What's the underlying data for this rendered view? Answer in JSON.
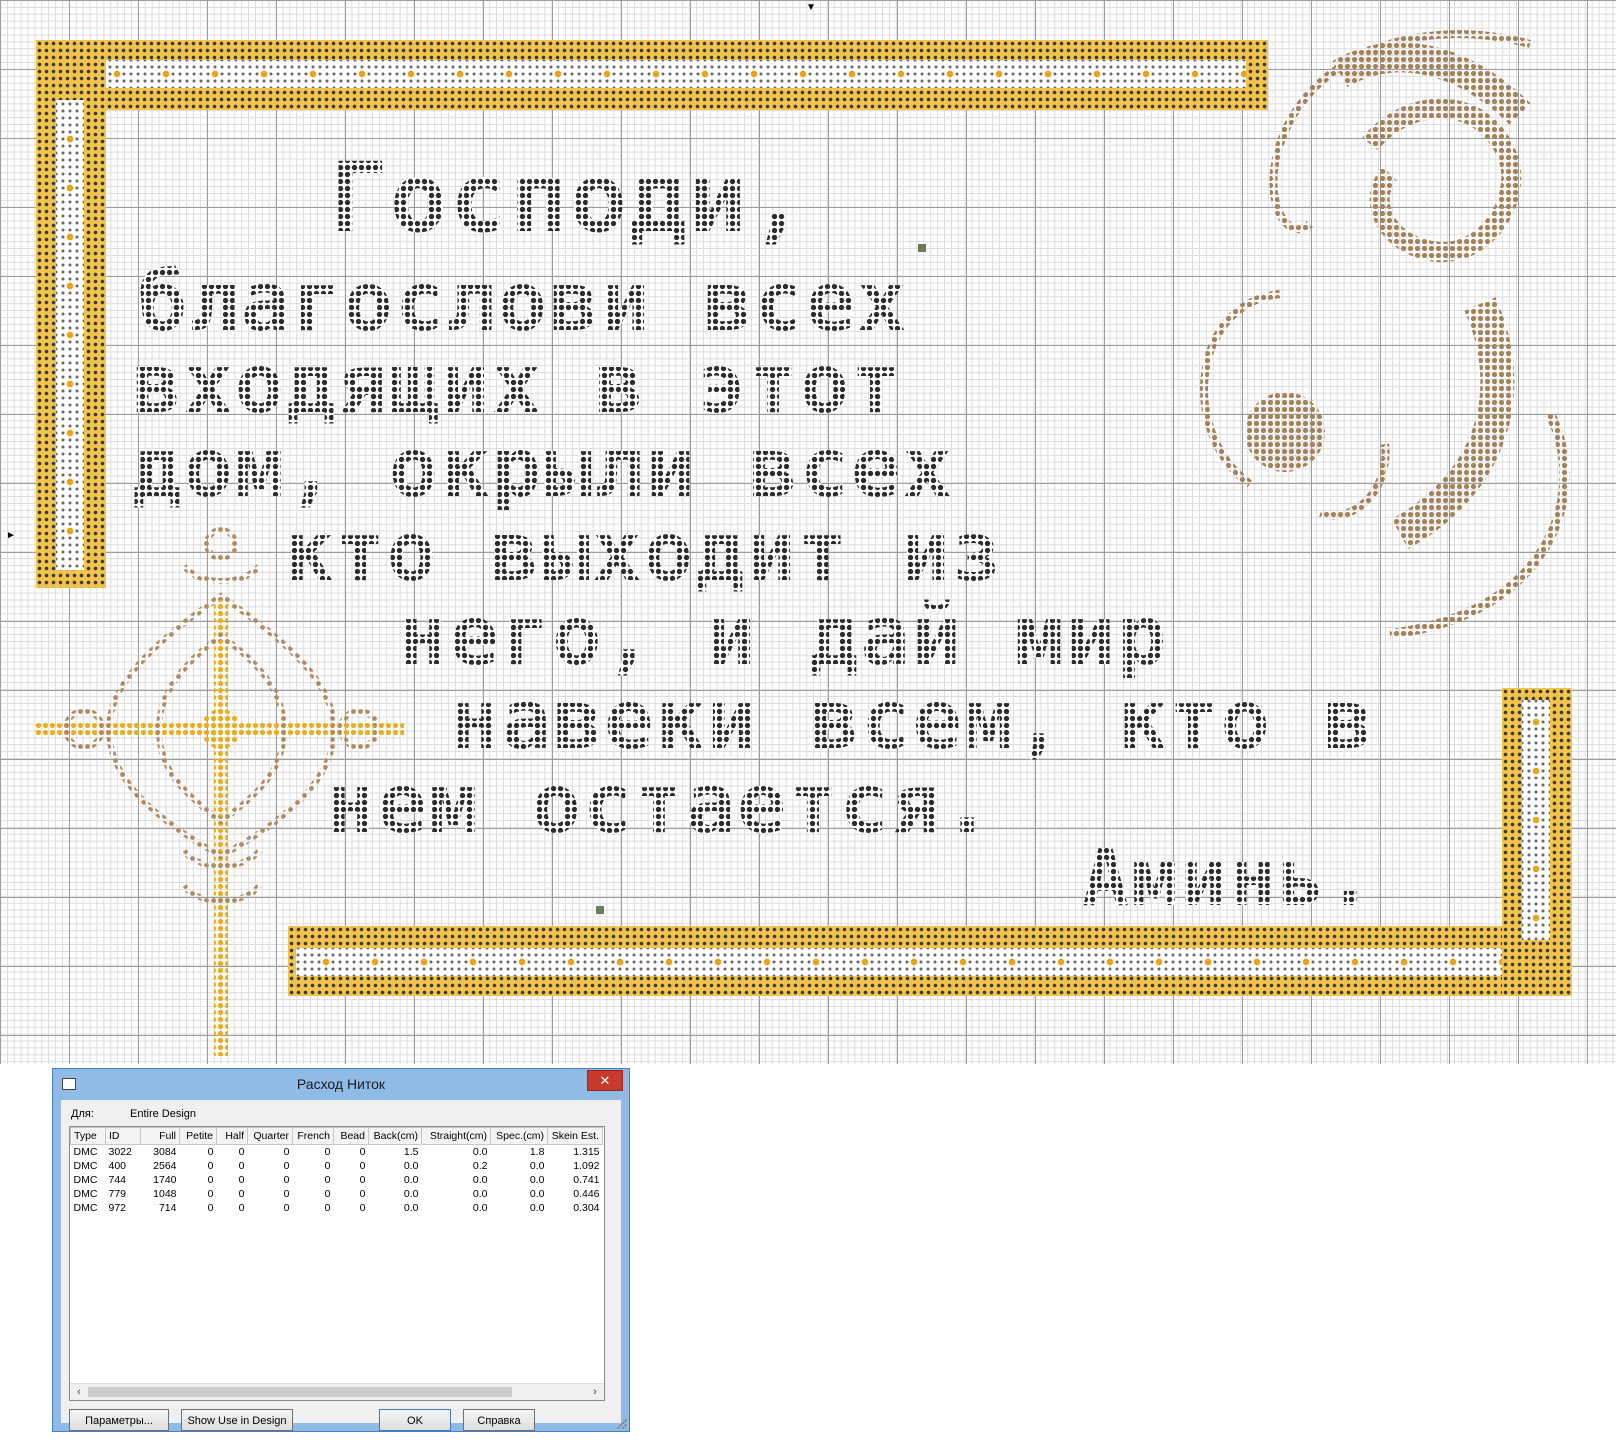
{
  "pattern": {
    "motto_lines": [
      "Господи,",
      "благослови всех",
      "входящих в этот",
      "дом, окрыли всех",
      "кто выходит из",
      "него, и дай мир",
      "навеки всем, кто в",
      "нем остается.",
      "Аминь."
    ],
    "colors": {
      "text": "#2c2c2c",
      "border_gold": "#f2c44e",
      "border_accent": "#e8a41a",
      "ornament_brown": "#a5825a",
      "cross_gold": "#e8b020",
      "cross_outline": "#b08a63"
    }
  },
  "dialog": {
    "title": "Расход Ниток",
    "close_glyph": "✕",
    "for_label": "Для:",
    "scope_value": "Entire Design",
    "columns": [
      "Type",
      "ID",
      "Full",
      "Petite",
      "Half",
      "Quarter",
      "French",
      "Bead",
      "Back(cm)",
      "Straight(cm)",
      "Spec.(cm)",
      "Skein Est."
    ],
    "rows": [
      [
        "DMC",
        "3022",
        "3084",
        "0",
        "0",
        "0",
        "0",
        "0",
        "1.5",
        "0.0",
        "1.8",
        "1.315"
      ],
      [
        "DMC",
        "400",
        "2564",
        "0",
        "0",
        "0",
        "0",
        "0",
        "0.0",
        "0.2",
        "0.0",
        "1.092"
      ],
      [
        "DMC",
        "744",
        "1740",
        "0",
        "0",
        "0",
        "0",
        "0",
        "0.0",
        "0.0",
        "0.0",
        "0.741"
      ],
      [
        "DMC",
        "779",
        "1048",
        "0",
        "0",
        "0",
        "0",
        "0",
        "0.0",
        "0.0",
        "0.0",
        "0.446"
      ],
      [
        "DMC",
        "972",
        "714",
        "0",
        "0",
        "0",
        "0",
        "0",
        "0.0",
        "0.0",
        "0.0",
        "0.304"
      ]
    ],
    "scroll_left": "‹",
    "scroll_right": "›",
    "buttons": {
      "params": "Параметры...",
      "show_use": "Show Use in Design",
      "ok": "OK",
      "help": "Справка"
    }
  }
}
